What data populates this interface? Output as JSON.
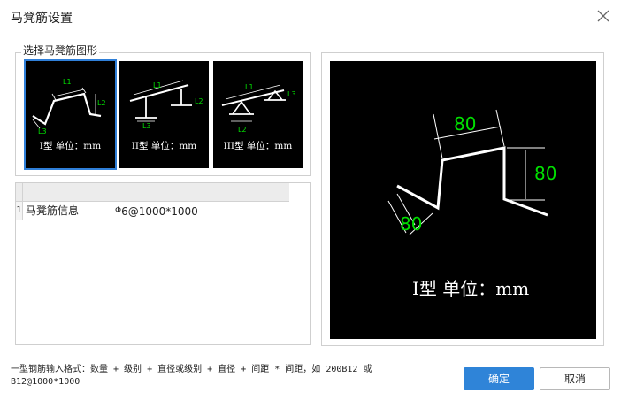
{
  "window": {
    "title": "马凳筋设置"
  },
  "shape_group": {
    "legend": "选择马凳筋图形",
    "options": [
      {
        "label": "I型 单位：mm",
        "dim_labels": [
          "L1",
          "L2",
          "L3"
        ],
        "selected": true
      },
      {
        "label": "II型 单位：mm",
        "dim_labels": [
          "L1",
          "L2",
          "L3"
        ],
        "selected": false
      },
      {
        "label": "III型 单位：mm",
        "dim_labels": [
          "L1",
          "L2",
          "L3"
        ],
        "selected": false
      }
    ]
  },
  "grid": {
    "columns": [
      "",
      ""
    ],
    "rows": [
      {
        "index": "1",
        "name": "马凳筋信息",
        "value_prefix": "Φ",
        "value": "6@1000*1000"
      }
    ]
  },
  "preview": {
    "label": "I型 单位：mm",
    "dims": {
      "top": "80",
      "right": "80",
      "left": "80"
    },
    "dim_color": "#00e000"
  },
  "hint": "一型钢筋输入格式：数量 + 级别 + 直径或级别 + 直径 + 间距 * 间距，如 200B12 或 B12@1000*1000",
  "buttons": {
    "ok": "确定",
    "cancel": "取消"
  },
  "colors": {
    "accent": "#2f84d8"
  }
}
